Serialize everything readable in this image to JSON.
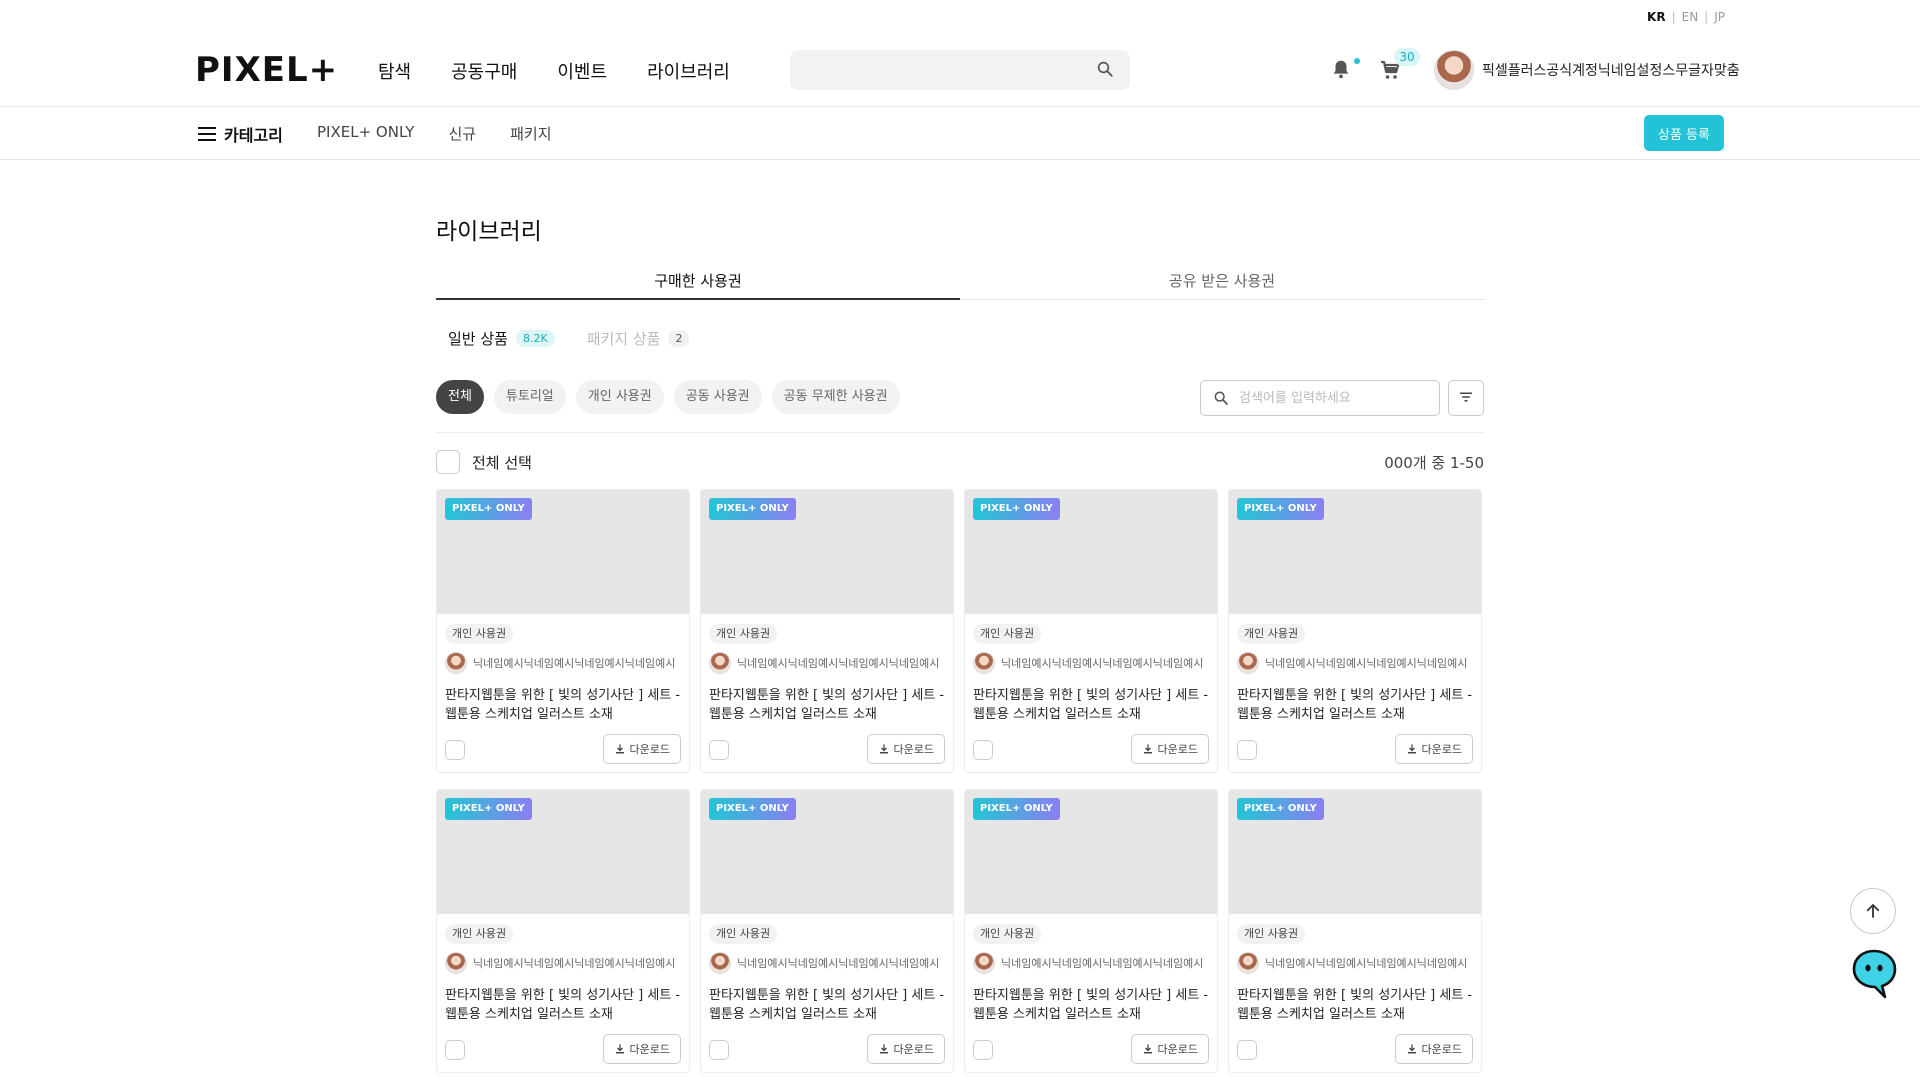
{
  "lang": {
    "items": [
      "KR",
      "EN",
      "JP"
    ],
    "active": "KR",
    "sep": "|"
  },
  "header": {
    "logo": "PIXEL+",
    "nav": [
      "탐색",
      "공동구매",
      "이벤트",
      "라이브러리"
    ],
    "search_placeholder": "",
    "cart_count": "30",
    "username": "픽셀플러스공식계정닉네임설정스무글자맞춤"
  },
  "subnav": {
    "category": "카테고리",
    "links": [
      "PIXEL+ ONLY",
      "신규",
      "패키지"
    ],
    "register": "상품 등록"
  },
  "main": {
    "title": "라이브러리",
    "tabs": [
      {
        "label": "구매한 사용권",
        "active": true
      },
      {
        "label": "공유 받은 사용권",
        "active": false
      }
    ],
    "subtabs": [
      {
        "label": "일반 상품",
        "count": "8.2K"
      },
      {
        "label": "패키지 상품",
        "count": "2"
      }
    ],
    "chips": [
      "전체",
      "튜토리얼",
      "개인 사용권",
      "공동 사용권",
      "공동 무제한 사용권"
    ],
    "search_placeholder": "검색어를 입력하세요",
    "select_all": "전체 선택",
    "result_count": "000개 중 1-50"
  },
  "card": {
    "badge": "PIXEL+ ONLY",
    "license": "개인 사용권",
    "author": "닉네임예시닉네임예시닉네임예시닉네임예시",
    "title": "판타지웹툰을 위한 [ 빛의 성기사단 ] 세트 - 웹툰용 스케치업 일러스트 소재",
    "download": "다운로드"
  },
  "colors": {
    "accent": "#22c3d6",
    "badge_from": "#23c6d4",
    "badge_to": "#8b7ff2"
  }
}
